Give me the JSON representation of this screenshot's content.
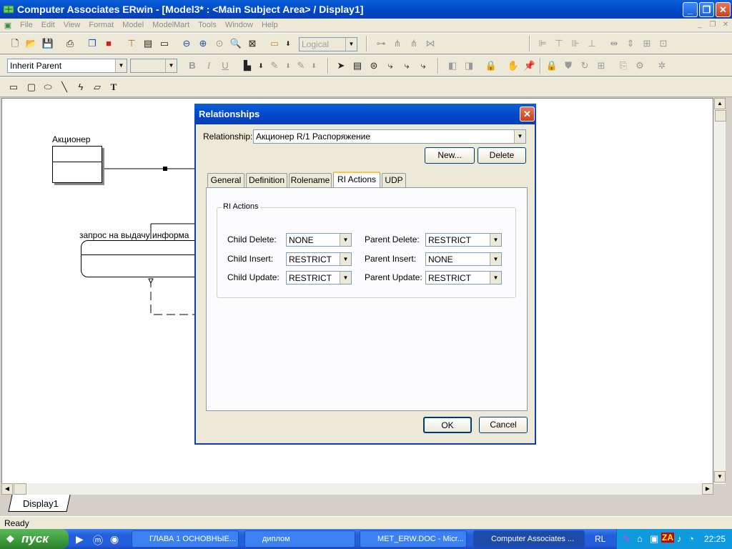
{
  "window": {
    "title": "Computer Associates ERwin - [Model3* : <Main Subject Area> / Display1]",
    "buttons": {
      "minimize": "_",
      "restore": "❐",
      "close": "✕"
    }
  },
  "menu": [
    "File",
    "Edit",
    "View",
    "Format",
    "Model",
    "ModelMart",
    "Tools",
    "Window",
    "Help"
  ],
  "toolbar": {
    "view_combo": "Logical",
    "inherit_combo": "Inherit Parent",
    "bold": "B",
    "italic": "I",
    "underline": "U",
    "text_tool": "T"
  },
  "diagram": {
    "entity1": "Акционер",
    "entity2": "запрос на выдачу информа"
  },
  "dialog": {
    "title": "Relationships",
    "relationship_label": "Relationship:",
    "relationship_value": "Акционер R/1 Распоряжение",
    "new_button": "New...",
    "delete_button": "Delete",
    "tabs": [
      "General",
      "Definition",
      "Rolename",
      "RI Actions",
      "UDP"
    ],
    "active_tab": "RI Actions",
    "group_label": "RI Actions",
    "fields": {
      "child_delete": {
        "label": "Child Delete:",
        "value": "NONE"
      },
      "child_insert": {
        "label": "Child Insert:",
        "value": "RESTRICT"
      },
      "child_update": {
        "label": "Child Update:",
        "value": "RESTRICT"
      },
      "parent_delete": {
        "label": "Parent Delete:",
        "value": "RESTRICT"
      },
      "parent_insert": {
        "label": "Parent Insert:",
        "value": "NONE"
      },
      "parent_update": {
        "label": "Parent Update:",
        "value": "RESTRICT"
      }
    },
    "ok_button": "OK",
    "cancel_button": "Cancel"
  },
  "display_tab": "Display1",
  "status": "Ready",
  "taskbar": {
    "start": "пуск",
    "tasks": [
      "ГЛАВА 1 ОСНОВНЫЕ...",
      "диплом",
      "MET_ERW.DOC - Micr...",
      "Computer Associates ..."
    ],
    "lang": "RL",
    "clock": "22:25"
  }
}
